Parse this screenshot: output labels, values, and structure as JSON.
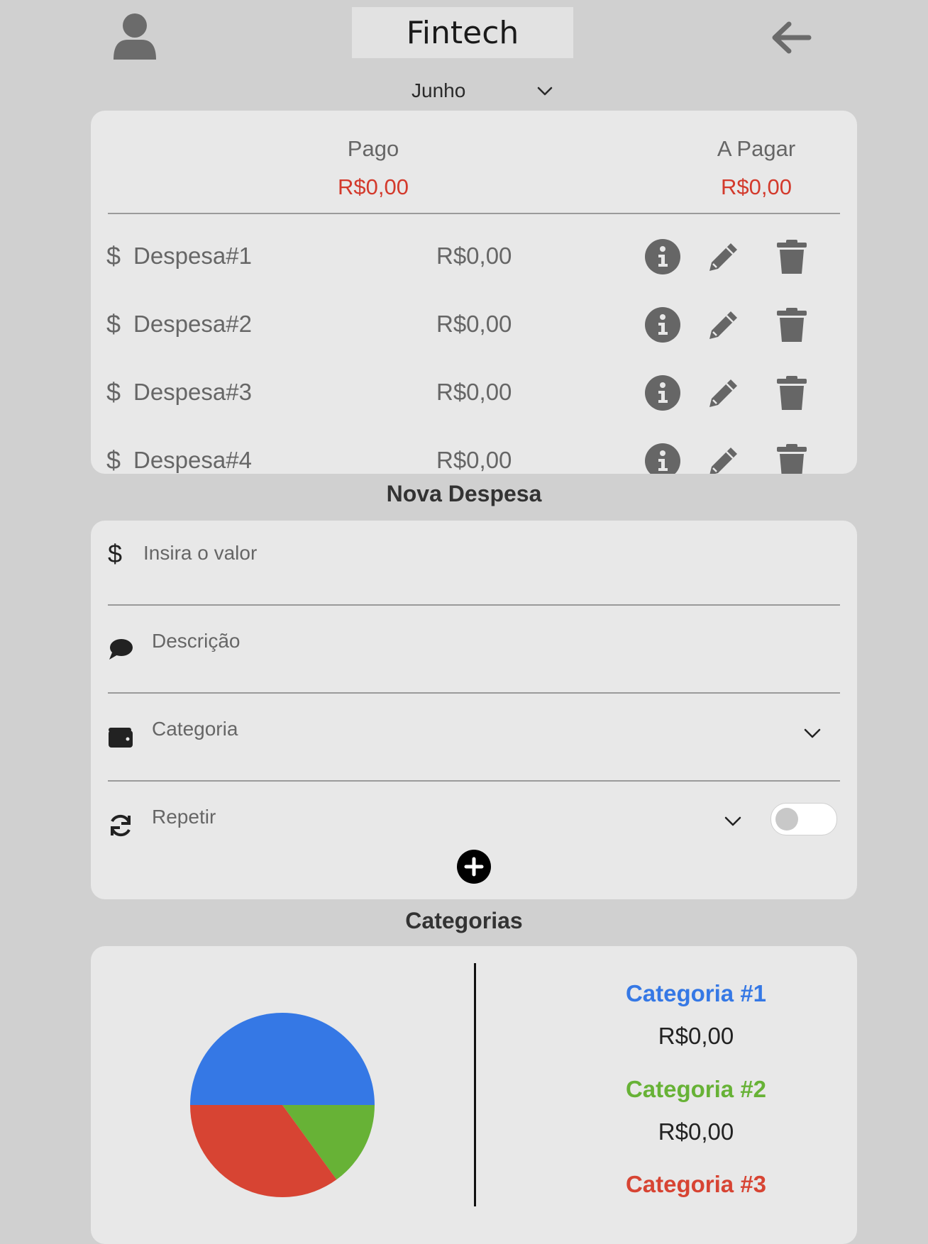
{
  "header": {
    "title": "Fintech",
    "month": "Junho"
  },
  "summary": {
    "paid_label": "Pago",
    "paid_value": "R$0,00",
    "due_label": "A Pagar",
    "due_value": "R$0,00",
    "value_color": "#d33a2c"
  },
  "expenses": [
    {
      "name": "Despesa#1",
      "amount": "R$0,00"
    },
    {
      "name": "Despesa#2",
      "amount": "R$0,00"
    },
    {
      "name": "Despesa#3",
      "amount": "R$0,00"
    },
    {
      "name": "Despesa#4",
      "amount": "R$0,00"
    }
  ],
  "new_expense": {
    "title": "Nova Despesa",
    "value_placeholder": "Insira o valor",
    "description_placeholder": "Descrição",
    "category_placeholder": "Categoria",
    "repeat_label": "Repetir",
    "repeat_enabled": false
  },
  "categories": {
    "title": "Categorias",
    "items": [
      {
        "name": "Categoria #1",
        "value": "R$0,00",
        "color": "#3578e5"
      },
      {
        "name": "Categoria #2",
        "value": "R$0,00",
        "color": "#67b236"
      },
      {
        "name": "Categoria #3",
        "value": "",
        "color": "#d74433"
      }
    ]
  },
  "chart_data": {
    "type": "pie",
    "categories": [
      "Categoria #1",
      "Categoria #2",
      "Categoria #3"
    ],
    "values": [
      50,
      15,
      35
    ],
    "colors": [
      "#3578e5",
      "#67b236",
      "#d74433"
    ]
  }
}
